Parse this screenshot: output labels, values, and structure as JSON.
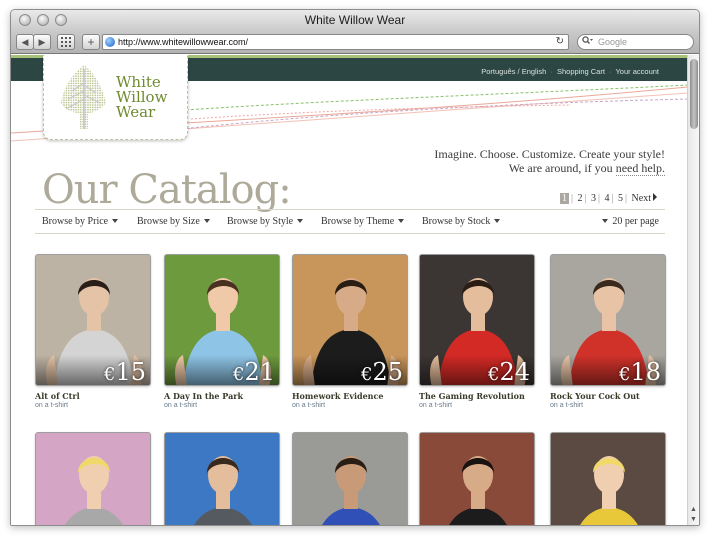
{
  "window": {
    "title": "White Willow Wear"
  },
  "browser": {
    "url": "http://www.whitewillowwear.com/",
    "search_placeholder": "Google",
    "back": "◀",
    "forward": "▶",
    "add": "+",
    "reload": "↻"
  },
  "topbar": {
    "links": [
      "Português / English",
      "Shopping Cart",
      "Your account"
    ],
    "separator": "·"
  },
  "logo": {
    "line1": "White",
    "line2": "Willow",
    "line3": "Wear"
  },
  "tagline": {
    "line1": "Imagine. Choose. Customize. Create your style!",
    "line2a": "We are around, if you ",
    "line2b": "need help."
  },
  "catalog": {
    "title": "Our Catalog:"
  },
  "pagination": {
    "pages": [
      "1",
      "2",
      "3",
      "4",
      "5"
    ],
    "current": "1",
    "next": "Next"
  },
  "filters": {
    "price": "Browse by Price",
    "size": "Browse by Size",
    "style": "Browse by Style",
    "theme": "Browse by Theme",
    "stock": "Browse by Stock",
    "per_page": "20 per page"
  },
  "currency": "€",
  "products": [
    {
      "name": "Alt of Ctrl",
      "sub": "on a t-shirt",
      "price": "15",
      "bg": "#bdb3a4",
      "shirt": "#d4d4d4",
      "skin": "#e4c3a6",
      "hair": "#2a1e18"
    },
    {
      "name": "A Day In the Park",
      "sub": "on a t-shirt",
      "price": "21",
      "bg": "#6e9a3e",
      "shirt": "#8ec4e6",
      "skin": "#f0c9a8",
      "hair": "#4a3020"
    },
    {
      "name": "Homework Evidence",
      "sub": "on a t-shirt",
      "price": "25",
      "bg": "#c8955a",
      "shirt": "#1c1c1c",
      "skin": "#d8ab88",
      "hair": "#2a1d14"
    },
    {
      "name": "The Gaming Revolution",
      "sub": "on a t-shirt",
      "price": "24",
      "bg": "#3b3533",
      "shirt": "#d42a26",
      "skin": "#e4bd9c",
      "hair": "#2a1d14"
    },
    {
      "name": "Rock Your Cock Out",
      "sub": "on a t-shirt",
      "price": "18",
      "bg": "#a9a6a0",
      "shirt": "#d0322a",
      "skin": "#e8c3a6",
      "hair": "#3a2a1e"
    },
    {
      "name": "",
      "sub": "",
      "price": "",
      "bg": "#d4a5c4",
      "shirt": "#a8a8a8",
      "skin": "#f0cfb0",
      "hair": "#f1d86a"
    },
    {
      "name": "",
      "sub": "",
      "price": "",
      "bg": "#3d78c4",
      "shirt": "#555a60",
      "skin": "#e4bd9c",
      "hair": "#3a2a1e"
    },
    {
      "name": "",
      "sub": "",
      "price": "",
      "bg": "#9a9a96",
      "shirt": "#3050b8",
      "skin": "#c89a78",
      "hair": "#2a1d14"
    },
    {
      "name": "",
      "sub": "",
      "price": "",
      "bg": "#8a4a3a",
      "shirt": "#1c1c1c",
      "skin": "#d8ab88",
      "hair": "#1a1410"
    },
    {
      "name": "",
      "sub": "",
      "price": "",
      "bg": "#5a4a42",
      "shirt": "#e8c838",
      "skin": "#f0cfb0",
      "hair": "#f1d86a"
    }
  ]
}
